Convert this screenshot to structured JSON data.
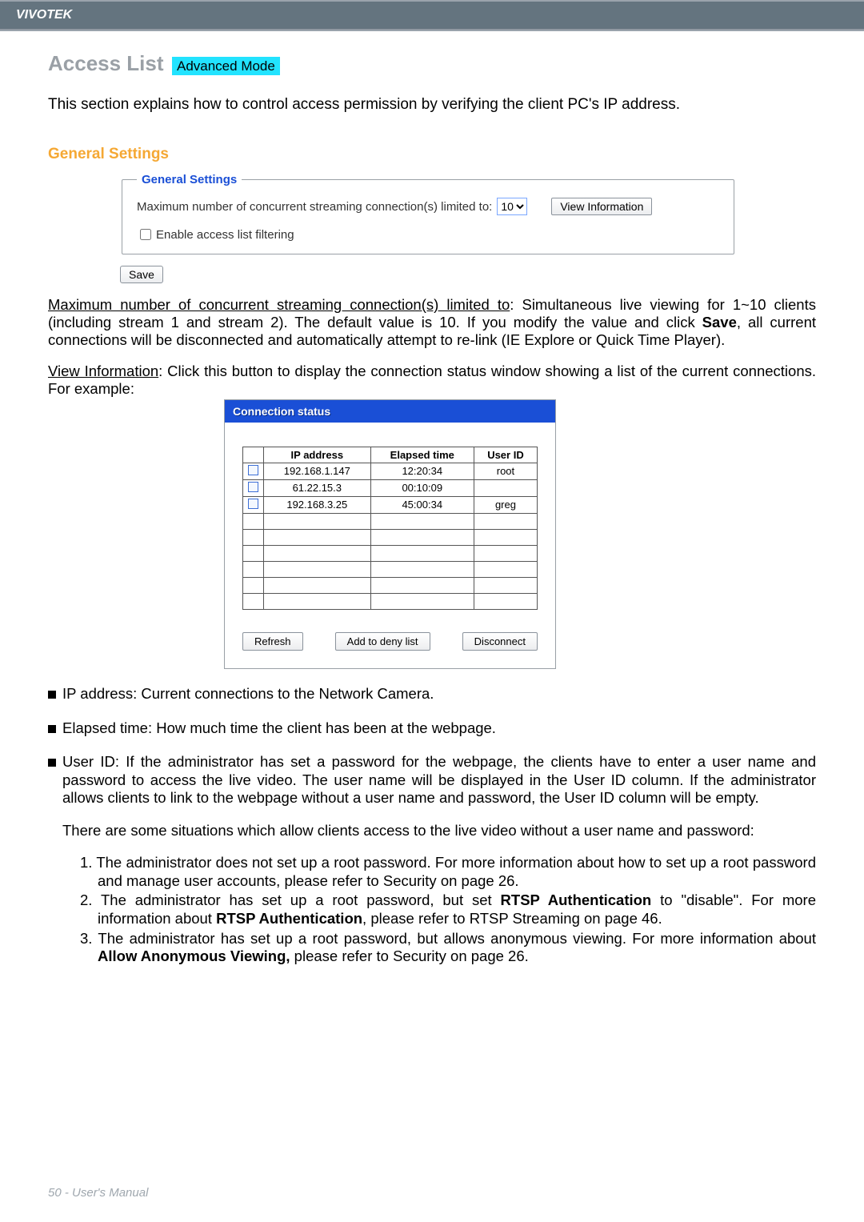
{
  "header": {
    "brand": "VIVOTEK"
  },
  "title": {
    "text": "Access List",
    "badge": "Advanced Mode"
  },
  "intro": "This section explains how to control access permission by verifying the client PC's IP address.",
  "generalSettingsHeading": "General Settings",
  "gs": {
    "legend": "General Settings",
    "max_label": "Maximum number of concurrent streaming connection(s) limited to:",
    "select_value": "10",
    "view_info": "View Information",
    "enable_filter": "Enable access list filtering",
    "save": "Save"
  },
  "para1": {
    "underline": "Maximum number of concurrent streaming connection(s) limited to",
    "rest": ": Simultaneous live viewing for 1~10 clients (including stream 1 and stream 2). The default value is 10. If you modify the value and click ",
    "saveWord": "Save",
    "rest2": ", all current connections will be disconnected and automatically attempt to re-link (IE Explore or Quick Time Player)."
  },
  "para2": {
    "underline": "View Information",
    "rest": ": Click this button to display the connection status window showing a list of the current connections. For example:"
  },
  "conn": {
    "title": "Connection status",
    "headers": [
      "",
      "IP address",
      "Elapsed time",
      "User ID"
    ],
    "rows": [
      {
        "ip": "192.168.1.147",
        "elapsed": "12:20:34",
        "user": "root"
      },
      {
        "ip": "61.22.15.3",
        "elapsed": "00:10:09",
        "user": ""
      },
      {
        "ip": "192.168.3.25",
        "elapsed": "45:00:34",
        "user": "greg"
      }
    ],
    "empty_rows": 6,
    "buttons": {
      "refresh": "Refresh",
      "deny": "Add to deny list",
      "disconnect": "Disconnect"
    }
  },
  "bullets": {
    "ip": "IP address: Current connections to the Network Camera.",
    "elapsed": "Elapsed time: How much time the client has been at the webpage.",
    "userid_lead": "User ID: If the administrator has set a password for the webpage, the clients have to enter a user name and password to access the live video. The user name will be displayed in the User ID column. If  the administrator allows clients to link to the webpage without a user name and password, the User ID column will be empty.",
    "situations_lead": "There are some situations which allow clients access to the live video without a user name and password:",
    "n1a": "1. The administrator does not set up a root password. For more information about how to set up a root password and manage user accounts, please refer to Security on page 26.",
    "n2a": "2. The administrator has set up a root password, but set ",
    "n2b": "RTSP Authentication",
    "n2c": " to \"disable\". For more information about ",
    "n2d": "RTSP Authentication",
    "n2e": ", please refer to RTSP Streaming on page 46.",
    "n3a": "3. The administrator has set up a root password, but allows anonymous viewing. For more information about ",
    "n3b": "Allow Anonymous Viewing,",
    "n3c": " please refer to Security on page 26."
  },
  "footer": "50 - User's Manual"
}
